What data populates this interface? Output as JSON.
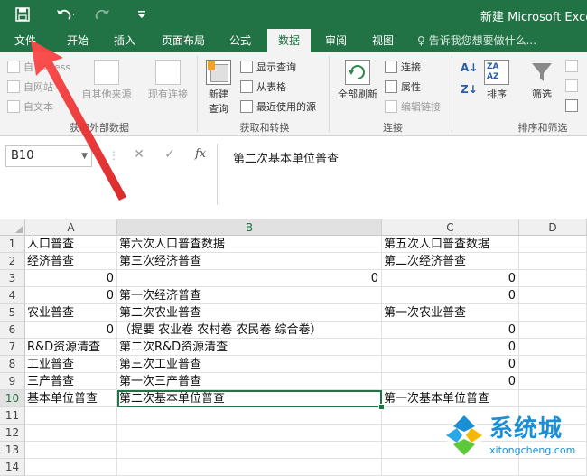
{
  "titlebar": {
    "save_icon": "save-icon",
    "undo_icon": "undo-icon",
    "redo_icon": "redo-icon",
    "customize_icon": "customize-qat-icon",
    "doc_title": "新建 Microsoft Excel"
  },
  "tabs": [
    {
      "label": "文件"
    },
    {
      "label": "开始"
    },
    {
      "label": "插入"
    },
    {
      "label": "页面布局"
    },
    {
      "label": "公式"
    },
    {
      "label": "数据"
    },
    {
      "label": "审阅"
    },
    {
      "label": "视图"
    }
  ],
  "active_tab": "数据",
  "tellme": "♀ 告诉我您想要做什么...",
  "ribbon": {
    "get_external": {
      "from_access": "自 Access",
      "from_web": "自网站",
      "from_text": "自文本",
      "from_other": "自其他来源",
      "existing": "现有连接",
      "group_label": "获取外部数据"
    },
    "get_transform": {
      "new_query": "新建",
      "new_query_2": "查询",
      "show_queries": "显示查询",
      "from_table": "从表格",
      "recent_sources": "最近使用的源",
      "group_label": "获取和转换"
    },
    "connections": {
      "refresh_all": "全部刷新",
      "connections": "连接",
      "properties": "属性",
      "edit_links": "编辑链接",
      "group_label": "连接"
    },
    "sort_filter": {
      "sort": "排序",
      "filter": "筛选",
      "group_label": "排序和筛选"
    }
  },
  "formula_bar": {
    "name_box": "B10",
    "cancel": "✕",
    "enter": "✓",
    "fx": "fx",
    "content": "第二次基本单位普查"
  },
  "grid": {
    "columns": [
      "A",
      "B",
      "C",
      "D"
    ],
    "rows": [
      {
        "n": "1",
        "a": "人口普查",
        "b": "第六次人口普查数据",
        "c": "第五次人口普查数据"
      },
      {
        "n": "2",
        "a": "经济普查",
        "b": "第三次经济普查",
        "c": "第二次经济普查"
      },
      {
        "n": "3",
        "a": "0",
        "b": "0",
        "c": "0"
      },
      {
        "n": "4",
        "a": "0",
        "b": "第一次经济普查",
        "c": "0"
      },
      {
        "n": "5",
        "a": "农业普查",
        "b": "第二次农业普查",
        "c": "第一次农业普查"
      },
      {
        "n": "6",
        "a": "0",
        "b": "（提要 农业卷 农村卷 农民卷 综合卷）",
        "c": "0"
      },
      {
        "n": "7",
        "a": "R&D资源清查",
        "b": "第二次R&D资源清查",
        "c": "0"
      },
      {
        "n": "8",
        "a": "工业普查",
        "b": "第三次工业普查",
        "c": "0"
      },
      {
        "n": "9",
        "a": "三产普查",
        "b": "第一次三产普查",
        "c": "0"
      },
      {
        "n": "10",
        "a": "基本单位普查",
        "b": "第二次基本单位普查",
        "c": "第一次基本单位普查"
      },
      {
        "n": "11",
        "a": "",
        "b": "",
        "c": ""
      },
      {
        "n": "12",
        "a": "",
        "b": "",
        "c": ""
      },
      {
        "n": "13",
        "a": "",
        "b": "",
        "c": ""
      },
      {
        "n": "14",
        "a": "",
        "b": "",
        "c": ""
      }
    ]
  },
  "watermark": {
    "text": "系统城",
    "url": "xitongcheng.com"
  },
  "colors": {
    "excel_green": "#217346",
    "arrow_red": "#e03a3a",
    "watermark_blue": "#1a8fd6"
  }
}
